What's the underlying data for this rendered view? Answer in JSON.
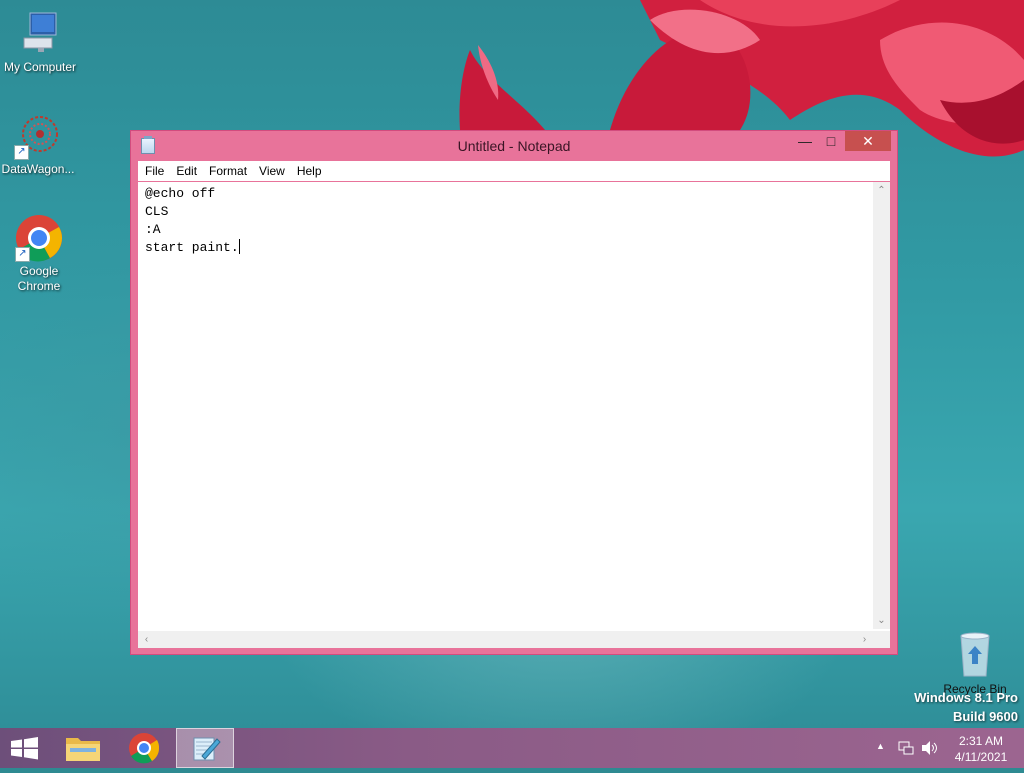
{
  "desktop": {
    "icons": [
      {
        "label": "My Computer"
      },
      {
        "label": "DataWagon..."
      },
      {
        "label": "Google Chrome"
      },
      {
        "label": "Recycle Bin"
      }
    ],
    "watermark": {
      "line1": "Windows 8.1 Pro",
      "line2": "Build 9600"
    }
  },
  "window": {
    "title": "Untitled - Notepad",
    "buttons": {
      "minimize": "—",
      "maximize": "□",
      "close": "✕"
    },
    "menu": [
      "File",
      "Edit",
      "Format",
      "View",
      "Help"
    ],
    "content": "@echo off\nCLS\n:A\nstart paint."
  },
  "taskbar": {
    "apps": [
      {
        "name": "start-button"
      },
      {
        "name": "file-explorer"
      },
      {
        "name": "google-chrome"
      },
      {
        "name": "notepad",
        "active": true
      }
    ],
    "clock": {
      "time": "2:31 AM",
      "date": "4/11/2021"
    },
    "tray_icons": [
      "show-hidden-icons",
      "network-icon",
      "volume-icon"
    ]
  },
  "colors": {
    "window_frame": "#e8739a",
    "close_button": "#c7504f",
    "taskbar": "#8a5b86",
    "desktop": "#319aa4"
  }
}
